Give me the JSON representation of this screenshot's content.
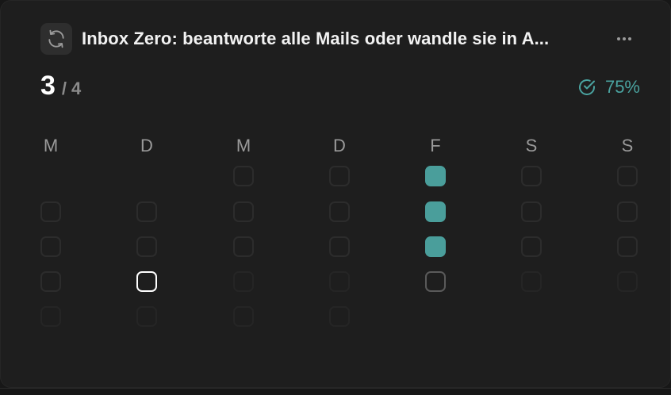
{
  "habit": {
    "title": "Inbox Zero: beantworte alle Mails oder wandle sie in A...",
    "icon": "repeat-icon",
    "more_icon": "more-horizontal-icon"
  },
  "progress": {
    "current": "3",
    "separator": "/",
    "total": "4",
    "percent_label": "75%",
    "percent_value": 0.75,
    "icon": "check-circle-icon"
  },
  "colors": {
    "accent": "#4aa3a0",
    "done": "#4a9e9b",
    "card": "#1e1e1e"
  },
  "weekdays": [
    "M",
    "D",
    "M",
    "D",
    "F",
    "S",
    "S"
  ],
  "calendar": {
    "legend_states": [
      "empty",
      "faint",
      "done",
      "today",
      "pending"
    ],
    "rows": [
      [
        null,
        null,
        "empty",
        "empty",
        "done",
        "empty",
        "empty"
      ],
      [
        "empty",
        "empty",
        "empty",
        "empty",
        "done",
        "empty",
        "empty"
      ],
      [
        "empty",
        "empty",
        "empty",
        "empty",
        "done",
        "empty",
        "empty"
      ],
      [
        "empty",
        "today",
        "faint",
        "faint",
        "pending",
        "faint",
        "faint"
      ],
      [
        "faint",
        "faint",
        "faint",
        "faint",
        null,
        null,
        null
      ]
    ]
  }
}
